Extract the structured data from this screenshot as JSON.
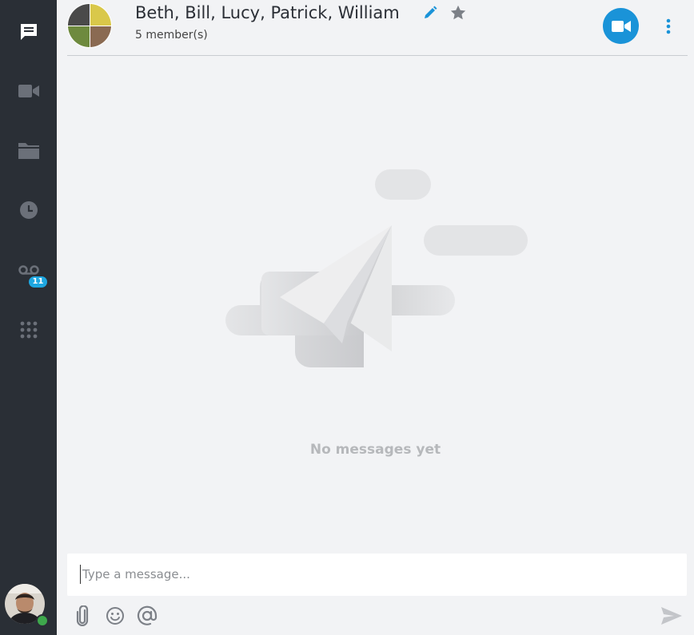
{
  "rail": {
    "items": [
      {
        "name": "chat",
        "icon": "chat-bubble-icon",
        "active": true
      },
      {
        "name": "video",
        "icon": "video-camera-icon"
      },
      {
        "name": "files",
        "icon": "folder-icon"
      },
      {
        "name": "recent",
        "icon": "clock-icon"
      },
      {
        "name": "voicemail",
        "icon": "voicemail-icon",
        "badge": "11"
      },
      {
        "name": "dialpad",
        "icon": "dialpad-icon"
      }
    ],
    "presence_color": "#3ea84c"
  },
  "header": {
    "title": "Beth, Bill, Lucy, Patrick, William",
    "subtitle": "5 member(s)"
  },
  "empty_state": {
    "text": "No messages yet"
  },
  "composer": {
    "placeholder": "Type a message..."
  },
  "colors": {
    "accent": "#1a93d8",
    "rail_bg": "#2a2f36",
    "badge": "#1ea7e1"
  }
}
